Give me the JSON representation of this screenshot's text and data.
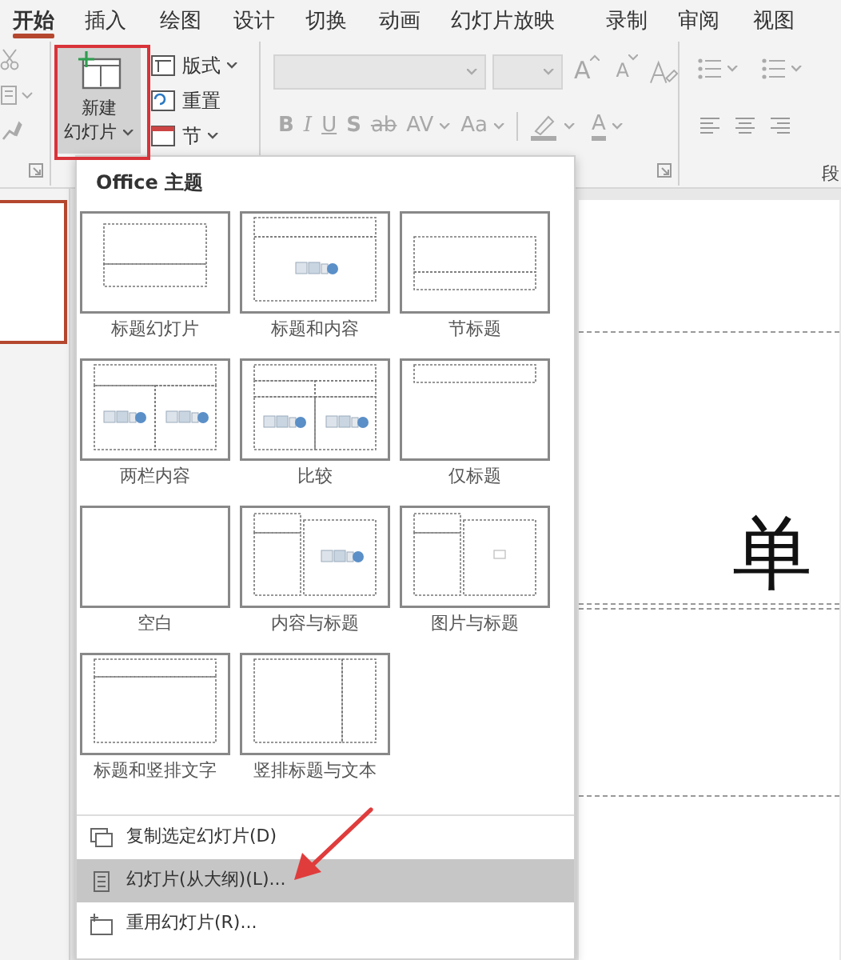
{
  "ribbon_tabs": [
    {
      "label": "开始",
      "selected": true
    },
    {
      "label": "插入",
      "selected": false
    },
    {
      "label": "绘图",
      "selected": false
    },
    {
      "label": "设计",
      "selected": false
    },
    {
      "label": "切换",
      "selected": false
    },
    {
      "label": "动画",
      "selected": false
    },
    {
      "label": "幻灯片放映",
      "selected": false
    },
    {
      "label": "录制",
      "selected": false
    },
    {
      "label": "审阅",
      "selected": false
    },
    {
      "label": "视图",
      "selected": false
    }
  ],
  "new_slide_button": {
    "label_lines": [
      "新建",
      "幻灯片"
    ],
    "selected": true
  },
  "slide_buttons": [
    {
      "label": "版式",
      "kind": "layout",
      "dropdown": true
    },
    {
      "label": "重置",
      "kind": "reset",
      "dropdown": false
    },
    {
      "label": "节",
      "kind": "section",
      "dropdown": true
    }
  ],
  "font_size_buttons": [
    {
      "label": "A",
      "kind": "grow"
    },
    {
      "label": "A",
      "kind": "shrink"
    }
  ],
  "format_buttons": [
    {
      "label": "B",
      "kind": "bold",
      "dropdown": false
    },
    {
      "label": "I",
      "kind": "italic",
      "dropdown": false
    },
    {
      "label": "U",
      "kind": "underline",
      "dropdown": false
    },
    {
      "label": "S",
      "kind": "shadow",
      "dropdown": false
    },
    {
      "label": "ab",
      "kind": "strike",
      "dropdown": false
    },
    {
      "label": "AV",
      "kind": "spacing",
      "dropdown": true
    },
    {
      "label": "Aa",
      "kind": "case",
      "dropdown": true
    }
  ],
  "font_color_button": {
    "label": "A"
  },
  "paragraph_group": {
    "label": "段"
  },
  "thumbnails": [
    {
      "selected": true
    }
  ],
  "slide": {
    "title_text": "单"
  },
  "layout_menu": {
    "header": "Office 主题",
    "layouts": [
      {
        "label": "标题幻灯片",
        "kind": "title"
      },
      {
        "label": "标题和内容",
        "kind": "title-content"
      },
      {
        "label": "节标题",
        "kind": "section"
      },
      {
        "label": "两栏内容",
        "kind": "two-content"
      },
      {
        "label": "比较",
        "kind": "comparison"
      },
      {
        "label": "仅标题",
        "kind": "title-only"
      },
      {
        "label": "空白",
        "kind": "blank"
      },
      {
        "label": "内容与标题",
        "kind": "content-caption"
      },
      {
        "label": "图片与标题",
        "kind": "picture-caption"
      },
      {
        "label": "标题和竖排文字",
        "kind": "vertical-text"
      },
      {
        "label": "竖排标题与文本",
        "kind": "vertical-title"
      }
    ],
    "commands": [
      {
        "label": "复制选定幻灯片(D)",
        "kind": "duplicate",
        "selected": false
      },
      {
        "label": "幻灯片(从大纲)(L)...",
        "kind": "outline",
        "selected": true
      },
      {
        "label": "重用幻灯片(R)...",
        "kind": "reuse",
        "selected": false
      }
    ]
  },
  "annotations": {
    "highlight_box": true,
    "arrow": true
  }
}
